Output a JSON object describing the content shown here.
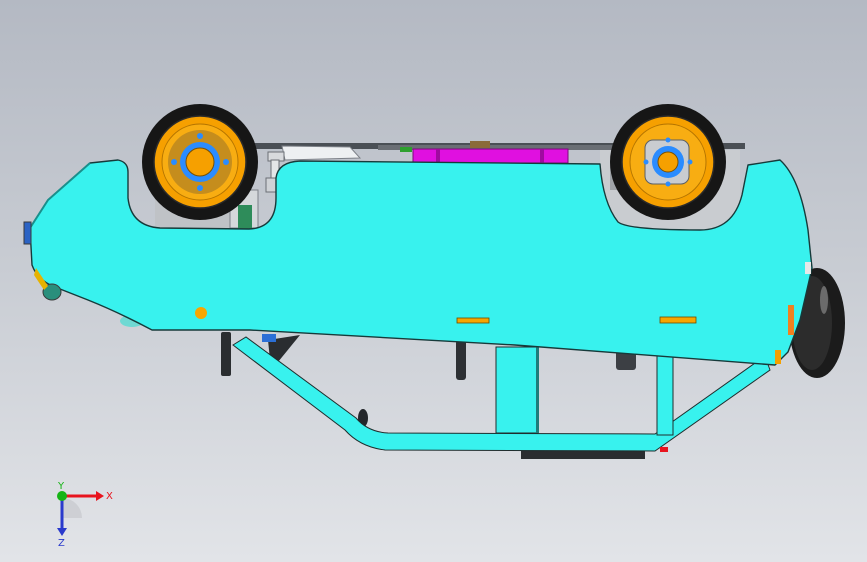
{
  "viewport": {
    "background_top": "#b4b9c3",
    "background_bottom": "#e2e4e8"
  },
  "model": {
    "body_color": "#38f2ee",
    "tire_color": "#1c1c1c",
    "rim_color": "#f6a000",
    "hub_color": "#2a8cff",
    "accent_magenta": "#e010e0",
    "marker_color": "#f7a600"
  },
  "triad": {
    "x_label": "X",
    "y_label": "Y",
    "z_label": "Z",
    "x_color": "#e8141e",
    "y_color": "#16b416",
    "z_color": "#2a3acc"
  }
}
